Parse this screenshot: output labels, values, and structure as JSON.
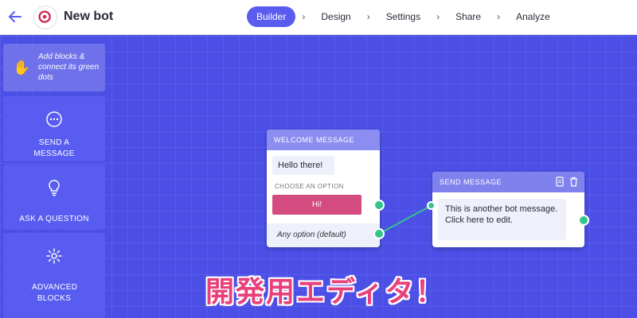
{
  "header": {
    "title": "New bot",
    "steps": [
      {
        "label": "Builder",
        "active": true
      },
      {
        "label": "Design"
      },
      {
        "label": "Settings"
      },
      {
        "label": "Share"
      },
      {
        "label": "Analyze"
      }
    ]
  },
  "sidebar": {
    "hint": "Add blocks & connect its green dots",
    "tools": [
      {
        "label": "SEND A MESSAGE",
        "icon": "chat-bubble-icon"
      },
      {
        "label": "ASK A QUESTION",
        "icon": "lightbulb-icon"
      },
      {
        "label": "ADVANCED BLOCKS",
        "icon": "gear-icon"
      }
    ]
  },
  "nodes": {
    "welcome": {
      "title": "WELCOME MESSAGE",
      "message": "Hello there!",
      "choose_label": "CHOOSE AN OPTION",
      "option": "Hi!",
      "default_option": "Any option (default)"
    },
    "send": {
      "title": "SEND MESSAGE",
      "message": "This is another bot message. Click here to edit."
    }
  },
  "caption": "開発用エディタ！",
  "colors": {
    "canvas": "#4b4fe6",
    "accent": "#5a5cf0",
    "option": "#d34b7f",
    "connector": "#33c58b"
  }
}
